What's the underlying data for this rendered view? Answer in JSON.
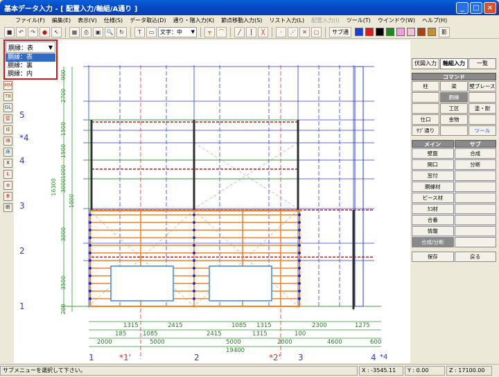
{
  "window": {
    "title": "基本データ入力 - [ 配置入力/軸組/A通り ]",
    "min": "_",
    "max": "□",
    "close": "×"
  },
  "menu": [
    {
      "label": "ファイル(F)",
      "disabled": false
    },
    {
      "label": "編集(E)",
      "disabled": false
    },
    {
      "label": "表示(V)",
      "disabled": false
    },
    {
      "label": "仕様(S)",
      "disabled": false
    },
    {
      "label": "データ取込(D)",
      "disabled": false
    },
    {
      "label": "通り・階入力(K)",
      "disabled": false
    },
    {
      "label": "節点移動入力(S)",
      "disabled": false
    },
    {
      "label": "リスト入力(L)",
      "disabled": false
    },
    {
      "label": "配置入力(I)",
      "disabled": true
    },
    {
      "label": "ツール(T)",
      "disabled": false
    },
    {
      "label": "ウインドウ(W)",
      "disabled": false
    },
    {
      "label": "ヘルプ(H)",
      "disabled": false
    }
  ],
  "toolbar": {
    "font_select": "文字：中",
    "sub_label": "サブ通",
    "shadow_label": "影",
    "palette": [
      "#1a3fe0",
      "#e01a1a",
      "#000000",
      "#1a8a1a",
      "#f0a0e0",
      "#f4c0d8",
      "#b04010",
      "#c89030"
    ]
  },
  "dropdown": {
    "selected": "胴縁：表",
    "options": [
      "胴縁：表",
      "胴縁：裏",
      "胴縁：内"
    ],
    "highlight_index": 0
  },
  "left_tools": [
    "MM",
    "T8",
    "GL",
    "壁",
    "IE",
    "IB",
    "床",
    "X",
    "L",
    "±",
    "B",
    "断"
  ],
  "drawing": {
    "gridlines_y": [
      "5",
      "*4",
      "4",
      "3",
      "2",
      "1"
    ],
    "gridlines_x": [
      "1",
      "*1'",
      "2",
      "*2'",
      "3",
      "4"
    ],
    "x4_extra": "*4",
    "dim_row1": [
      "1315",
      "2415",
      "1085",
      "1315",
      "2300",
      "1275"
    ],
    "dim_row2": [
      "185",
      "1085",
      "2415",
      "1315",
      "100"
    ],
    "dim_row3": [
      "2000",
      "5000",
      "5000",
      "2000",
      "4600",
      "600"
    ],
    "dim_total": "19400",
    "dim_left": [
      "900",
      "2700",
      "1500",
      "1500",
      "1000",
      "3000",
      "16300",
      "1000",
      "3000",
      "3500",
      "200"
    ]
  },
  "panel": {
    "tabs": [
      {
        "label": "伏図入力",
        "active": false
      },
      {
        "label": "軸組入力",
        "active": true
      },
      {
        "label": "一覧",
        "active": false
      }
    ],
    "command_header": "コマンド",
    "commands": [
      {
        "label": "柱",
        "style": "normal"
      },
      {
        "label": "梁",
        "style": "normal"
      },
      {
        "label": "壁ブレース",
        "style": "normal"
      },
      {
        "label": "",
        "style": "empty"
      },
      {
        "label": "胴縁",
        "style": "dark"
      },
      {
        "label": "",
        "style": "empty"
      },
      {
        "label": "",
        "style": "empty"
      },
      {
        "label": "工区",
        "style": "normal"
      },
      {
        "label": "塗・耐",
        "style": "normal"
      },
      {
        "label": "仕口",
        "style": "normal"
      },
      {
        "label": "金物",
        "style": "normal"
      },
      {
        "label": "",
        "style": "empty"
      },
      {
        "label": "ｻﾌﾞ通り",
        "style": "normal"
      },
      {
        "label": "",
        "style": "empty"
      },
      {
        "label": "ツール",
        "style": "blue"
      }
    ],
    "main_header": "メイン",
    "sub_header": "サブ",
    "main_items": [
      {
        "label": "壁面",
        "style": "normal"
      },
      {
        "label": "開口",
        "style": "normal"
      },
      {
        "label": "窓付",
        "style": "normal"
      },
      {
        "label": "胴縁材",
        "style": "normal"
      },
      {
        "label": "ピース材",
        "style": "normal"
      },
      {
        "label": "ｶｺ材",
        "style": "normal"
      },
      {
        "label": "合番",
        "style": "normal"
      },
      {
        "label": "情報",
        "style": "normal"
      },
      {
        "label": "合成/分断",
        "style": "dark"
      }
    ],
    "sub_items": [
      {
        "label": "合成"
      },
      {
        "label": "分断"
      }
    ],
    "save": "保存",
    "back": "戻る"
  },
  "status": {
    "message": "サブメニューを選択して下さい。",
    "x": "X : -3545.11",
    "y": "Y : 0.00",
    "z": "Z : 17100.00"
  }
}
